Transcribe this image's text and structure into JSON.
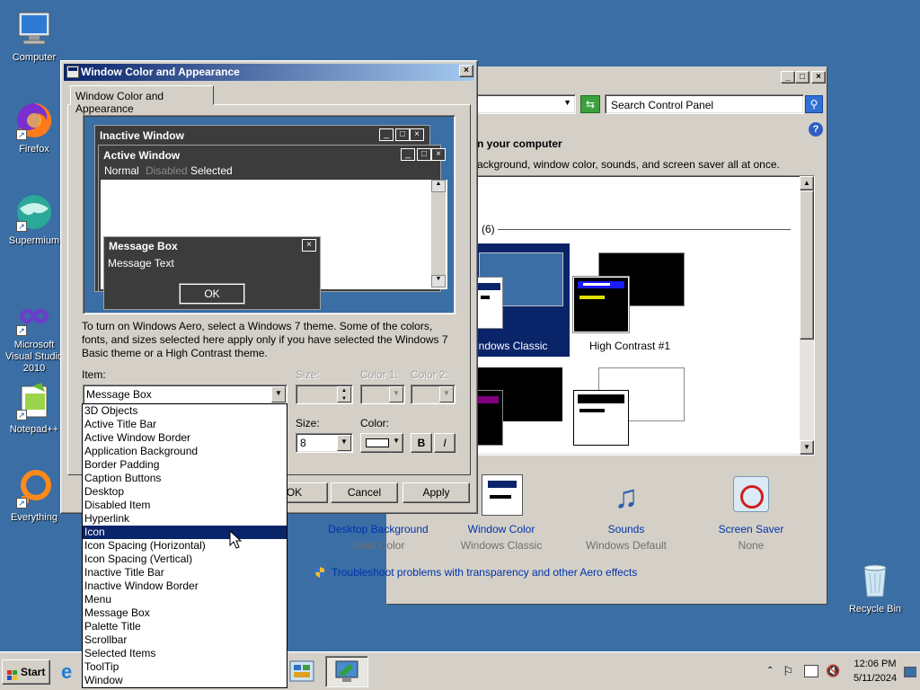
{
  "desktop": {
    "icons": [
      {
        "label": "Computer"
      },
      {
        "label": "Firefox"
      },
      {
        "label": "Supermium"
      },
      {
        "label": "Microsoft Visual Studio 2010"
      },
      {
        "label": "Notepad++"
      },
      {
        "label": "Everything"
      },
      {
        "label": "Recycle Bin"
      }
    ]
  },
  "control_panel": {
    "search_placeholder": "Search Control Panel",
    "heading": "n your computer",
    "subtext": "ackground, window color, sounds, and screen saver all at once.",
    "section_count": "(6)",
    "themes": [
      {
        "label": "indows Classic"
      },
      {
        "label": "High Contrast #1"
      }
    ],
    "bottom_items": [
      {
        "label": "Desktop Background",
        "value": "Solid Color"
      },
      {
        "label": "Window Color",
        "value": "Windows Classic"
      },
      {
        "label": "Sounds",
        "value": "Windows Default"
      },
      {
        "label": "Screen Saver",
        "value": "None"
      }
    ],
    "troubleshoot_link": "Troubleshoot problems with transparency and other Aero effects"
  },
  "dialog": {
    "title": "Window Color and Appearance",
    "tab": "Window Color and Appearance",
    "preview": {
      "inactive_title": "Inactive Window",
      "active_title": "Active Window",
      "menu_normal": "Normal",
      "menu_disabled": "Disabled",
      "menu_selected": "Selected",
      "msgbox_title": "Message Box",
      "msgbox_text": "Message Text",
      "ok": "OK"
    },
    "info_text": "To turn on Windows Aero, select a Windows 7 theme.  Some of the colors, fonts, and sizes selected here apply only if you have selected the Windows 7 Basic theme or a High Contrast theme.",
    "item_label": "Item:",
    "item_value": "Message Box",
    "size_label": "Size:",
    "color1_label": "Color 1:",
    "color2_label": "Color 2:",
    "font_size_label": "Size:",
    "font_size_value": "8",
    "font_color_label": "Color:",
    "bold": "B",
    "italic": "I",
    "ok_button": "OK",
    "cancel_button": "Cancel",
    "apply_button": "Apply",
    "item_options": [
      "3D Objects",
      "Active Title Bar",
      "Active Window Border",
      "Application Background",
      "Border Padding",
      "Caption Buttons",
      "Desktop",
      "Disabled Item",
      "Hyperlink",
      "Icon",
      "Icon Spacing (Horizontal)",
      "Icon Spacing (Vertical)",
      "Inactive Title Bar",
      "Inactive Window Border",
      "Menu",
      "Message Box",
      "Palette Title",
      "Scrollbar",
      "Selected Items",
      "ToolTip",
      "Window"
    ],
    "highlighted_option": "Icon"
  },
  "taskbar": {
    "start": "Start",
    "time": "12:06 PM",
    "date": "5/11/2024"
  },
  "colors": {
    "desktop": "#3a6ea5",
    "face": "#d4d0c8",
    "active_title_start": "#0a246a",
    "active_title_end": "#a6caf0",
    "selection": "#0a246a"
  }
}
